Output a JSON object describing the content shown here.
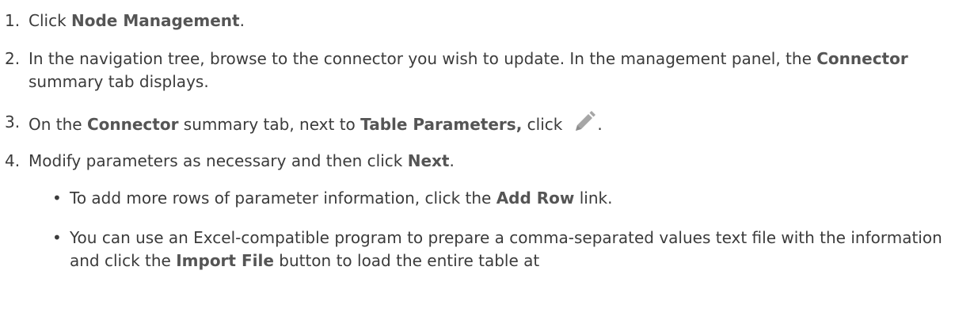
{
  "steps": [
    {
      "num": "1.",
      "parts": [
        "Click ",
        "Node Management",
        "."
      ]
    },
    {
      "num": "2.",
      "parts": [
        "In the navigation tree, browse to the connector you wish to update. In the management panel, the ",
        "Connector",
        " summary tab displays."
      ]
    },
    {
      "num": "3.",
      "parts": [
        "On the ",
        "Connector",
        " summary tab, next to ",
        "Table Parameters,",
        " click",
        "."
      ]
    },
    {
      "num": "4.",
      "parts": [
        "Modify parameters as necessary and then click ",
        "Next",
        "."
      ]
    }
  ],
  "bullets": [
    {
      "marker": "•",
      "parts": [
        "To add more rows of parameter information, click the ",
        "Add Row",
        " link."
      ]
    },
    {
      "marker": "•",
      "parts": [
        "You can use an Excel-compatible program to prepare a comma-separated values text file with the information and click the ",
        "Import File",
        " button to load the entire table at"
      ]
    }
  ],
  "icons": {
    "edit": "pencil-icon"
  },
  "colors": {
    "text": "#3b3b3b",
    "bold": "#555555",
    "icon": "#a6a6a6"
  }
}
